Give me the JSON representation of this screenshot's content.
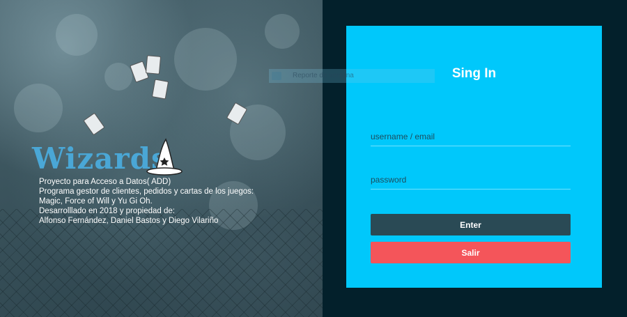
{
  "background": {
    "page_color": "#03202b"
  },
  "branding": {
    "logo_text": "Wizards",
    "logo_color": "#4aa7d6",
    "hat_icon": "wizard-hat-icon"
  },
  "description": {
    "lines": [
      "Proyecto para Acceso a Datos( ADD)",
      "Programa gestor de  clientes, pedidos y cartas de los juegos:",
      "Magic, Force of Will y Yu Gi Oh.",
      "Desarrolllado en 2018 y propiedad de:",
      "Alfonso Fernández, Daniel Bastos y Diego Vilariño"
    ]
  },
  "overlay": {
    "ghost_label": "Reporte de ventana"
  },
  "login": {
    "panel_color": "#00c8fb",
    "title": "Sing In",
    "username_placeholder": "username / email",
    "password_placeholder": "password",
    "enter_label": "Enter",
    "enter_color": "#2a4a55",
    "exit_label": "Salir",
    "exit_color": "#f4555a"
  }
}
